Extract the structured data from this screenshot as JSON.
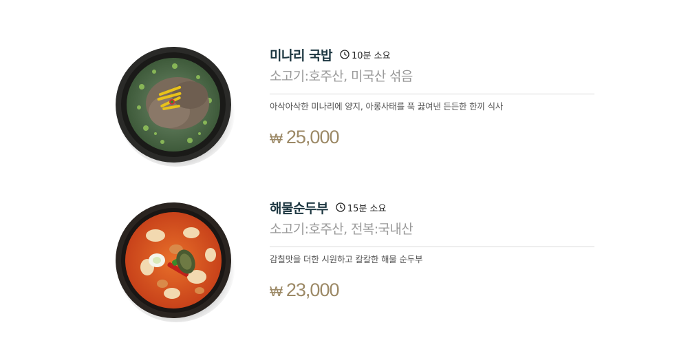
{
  "menu": [
    {
      "name": "미나리 국밥",
      "time": "10분 소요",
      "origin": "소고기:호주산, 미국산 섞음",
      "description": "아삭아삭한 미나리에 양지, 아롱사태를 푹 끓여낸 든든한 한끼 식사",
      "currency": "₩",
      "price": "25,000",
      "photo_icon": "gukbap-bowl-icon"
    },
    {
      "name": "해물순두부",
      "time": "15분 소요",
      "origin": "소고기:호주산, 전복:국내산",
      "description": "감칠맛을 더한 시원하고 칼칼한 해물 순두부",
      "currency": "₩",
      "price": "23,000",
      "photo_icon": "sundubu-bowl-icon"
    }
  ],
  "colors": {
    "title": "#1c3640",
    "origin": "#9a9a9a",
    "price": "#9c8966",
    "divider": "#d9d9d9"
  }
}
